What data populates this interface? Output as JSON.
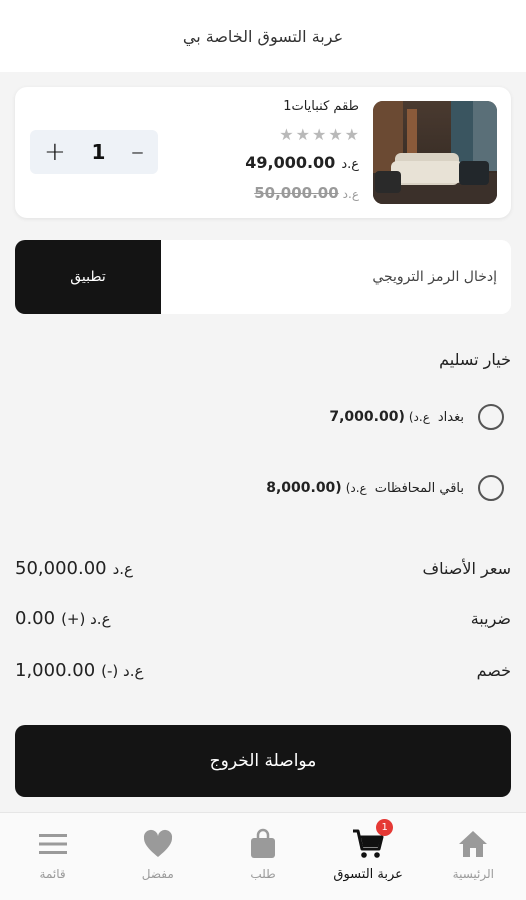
{
  "header": {
    "title": "عربة التسوق الخاصة بي"
  },
  "cart_item": {
    "name": "طقم كنبايات1",
    "rating_stars": 5,
    "rating_filled": 0,
    "currency": "ع.د",
    "price": "49,000.00",
    "old_price": "50,000.00",
    "quantity": "1",
    "plus_symbol": "+",
    "minus_symbol": "–"
  },
  "promo": {
    "placeholder": "إدخال الرمز الترويجي",
    "apply_label": "تطبيق"
  },
  "delivery": {
    "title": "خيار تسليم",
    "options": [
      {
        "label": "بغداد",
        "currency": "(ع.د",
        "price": "7,000.00)",
        "selected": false
      },
      {
        "label": "باقي المحافظات",
        "currency": "(ع.د",
        "price": "8,000.00)",
        "selected": false
      }
    ]
  },
  "summary": {
    "subtotal_label": "سعر الأصناف",
    "subtotal_currency": "ع.د",
    "subtotal_value": "50,000.00",
    "tax_label": "ضريبة",
    "tax_value": "0.00",
    "tax_currency": "(+) ع.د",
    "discount_label": "خصم",
    "discount_value": "1,000.00",
    "discount_currency": "(-) ع.د"
  },
  "checkout": {
    "label": "مواصلة الخروج"
  },
  "bottom_nav": {
    "items": [
      {
        "label": "الرئيسية",
        "icon": "home-icon"
      },
      {
        "label": "عربة التسوق",
        "icon": "cart-icon",
        "badge": "1",
        "active": true
      },
      {
        "label": "طلب",
        "icon": "bag-icon"
      },
      {
        "label": "مفضل",
        "icon": "heart-icon"
      },
      {
        "label": "قائمة",
        "icon": "menu-icon"
      }
    ]
  },
  "colors": {
    "primary": "#141414",
    "badge": "#e53935",
    "inactive": "#9a9a9a"
  }
}
